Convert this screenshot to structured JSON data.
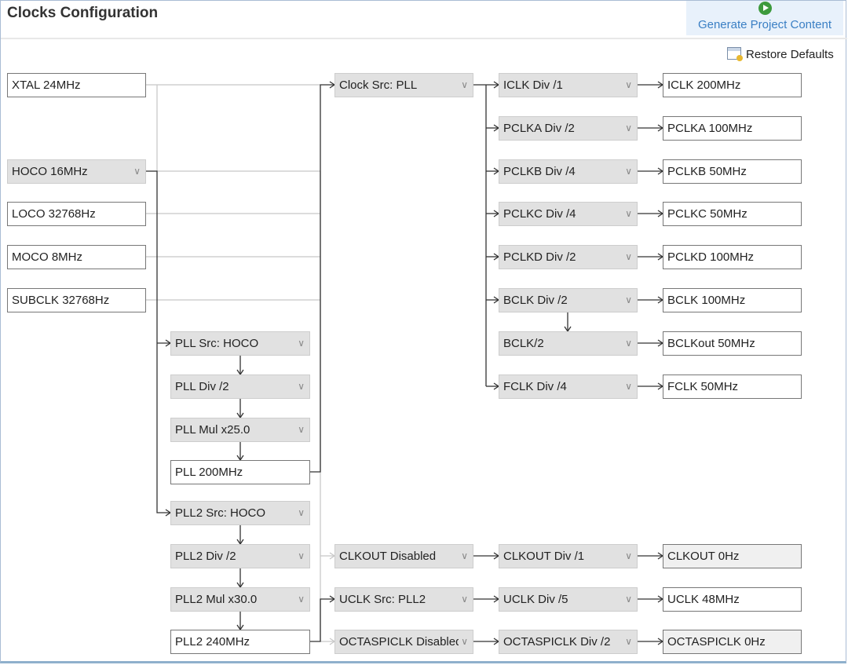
{
  "header": {
    "title": "Clocks Configuration",
    "generate_label": "Generate Project Content",
    "generate_icon": "play-icon",
    "restore_label": "Restore Defaults",
    "restore_icon": "restore-defaults-icon"
  },
  "colors": {
    "active_wire": "#333333",
    "inactive_wire": "#c8c8c8",
    "dropdown_bg": "#e1e1e1",
    "generate_text": "#3a7fc4"
  },
  "nodes": {
    "xtal": {
      "label": "XTAL 24MHz",
      "type": "value"
    },
    "hoco": {
      "label": "HOCO 16MHz",
      "type": "dropdown"
    },
    "loco": {
      "label": "LOCO 32768Hz",
      "type": "value"
    },
    "moco": {
      "label": "MOCO 8MHz",
      "type": "value"
    },
    "subclk": {
      "label": "SUBCLK 32768Hz",
      "type": "value"
    },
    "pll_src": {
      "label": "PLL Src: HOCO",
      "type": "dropdown"
    },
    "pll_div": {
      "label": "PLL Div /2",
      "type": "dropdown"
    },
    "pll_mul": {
      "label": "PLL Mul x25.0",
      "type": "dropdown"
    },
    "pll_out": {
      "label": "PLL 200MHz",
      "type": "value"
    },
    "pll2_src": {
      "label": "PLL2 Src: HOCO",
      "type": "dropdown"
    },
    "pll2_div": {
      "label": "PLL2 Div /2",
      "type": "dropdown"
    },
    "pll2_mul": {
      "label": "PLL2 Mul x30.0",
      "type": "dropdown"
    },
    "pll2_out": {
      "label": "PLL2 240MHz",
      "type": "value"
    },
    "clock_src": {
      "label": "Clock Src: PLL",
      "type": "dropdown"
    },
    "clkout_src": {
      "label": "CLKOUT Disabled",
      "type": "dropdown"
    },
    "uclk_src": {
      "label": "UCLK Src: PLL2",
      "type": "dropdown"
    },
    "octa_src": {
      "label": "OCTASPICLK Disabled",
      "type": "dropdown"
    },
    "iclk_div": {
      "label": "ICLK Div /1",
      "type": "dropdown"
    },
    "pclka_div": {
      "label": "PCLKA Div /2",
      "type": "dropdown"
    },
    "pclkb_div": {
      "label": "PCLKB Div /4",
      "type": "dropdown"
    },
    "pclkc_div": {
      "label": "PCLKC Div /4",
      "type": "dropdown"
    },
    "pclkd_div": {
      "label": "PCLKD Div /2",
      "type": "dropdown"
    },
    "bclk_div": {
      "label": "BCLK Div /2",
      "type": "dropdown"
    },
    "bclk2_div": {
      "label": "BCLK/2",
      "type": "dropdown"
    },
    "fclk_div": {
      "label": "FCLK Div /4",
      "type": "dropdown"
    },
    "clkout_div": {
      "label": "CLKOUT Div /1",
      "type": "dropdown"
    },
    "uclk_div": {
      "label": "UCLK Div /5",
      "type": "dropdown"
    },
    "octa_div": {
      "label": "OCTASPICLK Div /2",
      "type": "dropdown"
    },
    "iclk": {
      "label": "ICLK 200MHz",
      "type": "value"
    },
    "pclka": {
      "label": "PCLKA 100MHz",
      "type": "value"
    },
    "pclkb": {
      "label": "PCLKB 50MHz",
      "type": "value"
    },
    "pclkc": {
      "label": "PCLKC 50MHz",
      "type": "value"
    },
    "pclkd": {
      "label": "PCLKD 100MHz",
      "type": "value"
    },
    "bclk": {
      "label": "BCLK 100MHz",
      "type": "value"
    },
    "bclkout": {
      "label": "BCLKout 50MHz",
      "type": "value"
    },
    "fclk": {
      "label": "FCLK 50MHz",
      "type": "value"
    },
    "clkout": {
      "label": "CLKOUT 0Hz",
      "type": "value",
      "disabled": true
    },
    "uclk": {
      "label": "UCLK 48MHz",
      "type": "value"
    },
    "octaspiclk": {
      "label": "OCTASPICLK 0Hz",
      "type": "value",
      "disabled": true
    }
  }
}
